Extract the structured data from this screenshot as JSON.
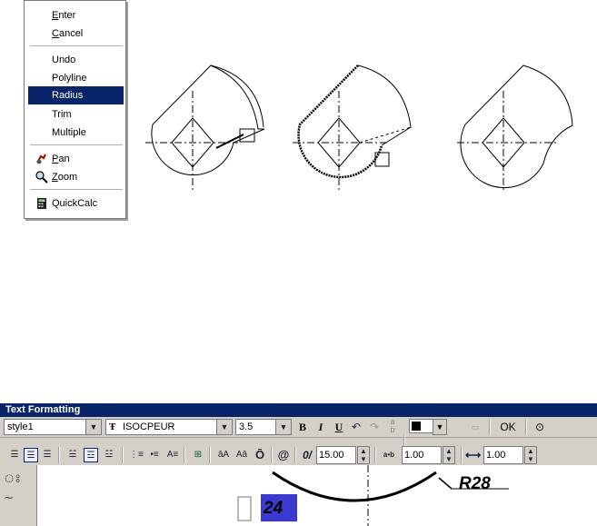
{
  "context_menu": {
    "items": [
      {
        "label": "Enter",
        "mnemonic": true
      },
      {
        "label": "Cancel",
        "mnemonic": true
      },
      {
        "label": "Undo"
      },
      {
        "label": "Polyline"
      },
      {
        "label": "Radius",
        "selected": true
      },
      {
        "label": "Trim"
      },
      {
        "label": "Multiple"
      },
      {
        "label": "Pan",
        "icon": "pan-icon",
        "mnemonic": true
      },
      {
        "label": "Zoom",
        "icon": "zoom-icon",
        "mnemonic": true
      },
      {
        "label": "QuickCalc",
        "icon": "calculator-icon"
      }
    ]
  },
  "text_formatting": {
    "title": "Text Formatting",
    "style": "style1",
    "font": "ISOCPEUR",
    "height": "3.5",
    "bold": "B",
    "italic": "I",
    "underline": "U",
    "ok_label": "OK",
    "oblique": "15.00",
    "tracking": "1.00",
    "width_factor": "1.00",
    "tracking_label": "a•b",
    "color_value": "#000000"
  },
  "canvas": {
    "dimension_label": "R28",
    "edit_text": "24"
  },
  "colors": {
    "menu_highlight": "#0a246a",
    "title_bar": "#0a246a",
    "toolbar_bg": "#d4d0c8"
  }
}
